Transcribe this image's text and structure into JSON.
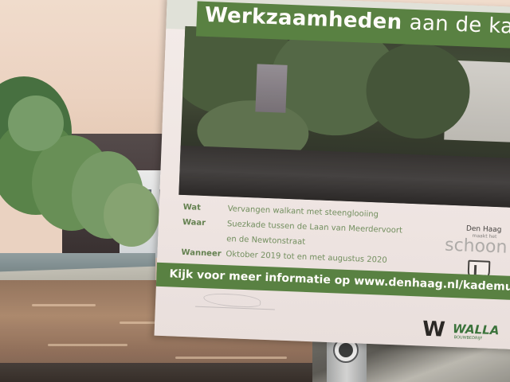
{
  "photo": {
    "scene": "canal-street",
    "colors": {
      "sign_green": "#4f7d3d",
      "sign_bg": "#efe8e8",
      "label_green": "#5b7d4c",
      "value_green": "#6a8b5b"
    }
  },
  "sign": {
    "title_bold": "Werkzaamheden",
    "title_light": "aan de kad",
    "info": [
      {
        "label": "Wat",
        "value": "Vervangen walkant met steenglooiing"
      },
      {
        "label": "Waar",
        "value": "Suezkade tussen de Laan van Meerdervoort"
      },
      {
        "label": "",
        "value": "en de Newtonstraat"
      },
      {
        "label": "Wanneer",
        "value": "Oktober 2019 tot en met augustus 2020"
      }
    ],
    "footer": "Kijk voor meer informatie op www.denhaag.nl/kademuren",
    "municipality": {
      "name": "Den Haag",
      "tagline": "maakt het",
      "word": "schoon"
    },
    "contractor": {
      "mark": "W",
      "name": "WALLA",
      "tagline": "BOUWBEDRIJF"
    }
  }
}
